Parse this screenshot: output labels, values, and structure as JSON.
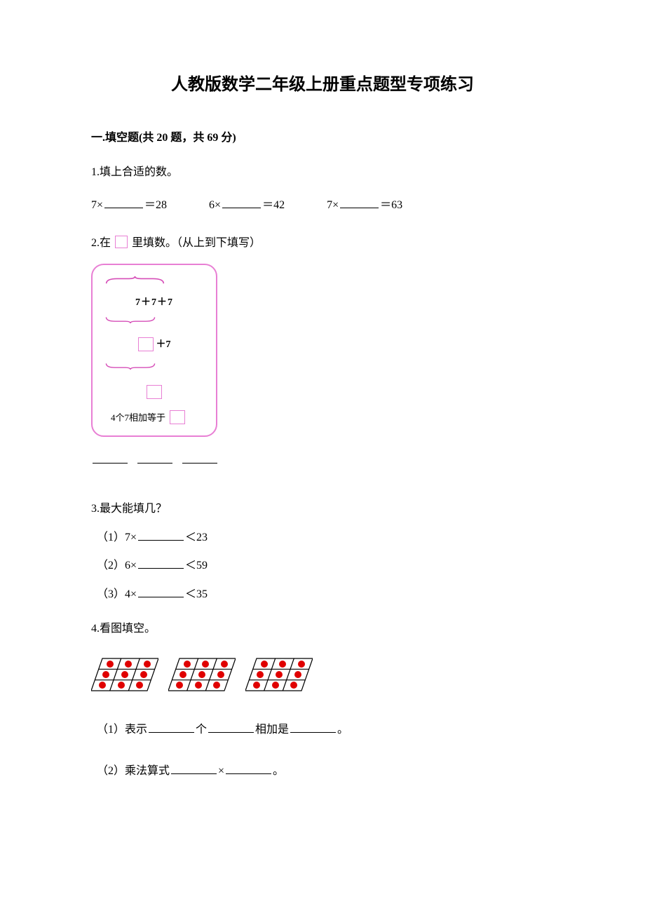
{
  "title": "人教版数学二年级上册重点题型专项练习",
  "section1": {
    "header": "一.填空题(共 20 题，共 69 分)",
    "q1": {
      "prompt": "1.填上合适的数。",
      "items": [
        {
          "left": "7×",
          "right": "＝28"
        },
        {
          "left": "6×",
          "right": "＝42"
        },
        {
          "left": "7×",
          "right": "＝63"
        }
      ]
    },
    "q2": {
      "prompt_prefix": "2.在",
      "prompt_suffix": "里填数。（从上到下填写）",
      "line1": "7＋7＋7",
      "line2_suffix": "＋7",
      "line4_prefix": "4个7相加等于"
    },
    "q3": {
      "prompt": "3.最大能填几？",
      "subs": [
        {
          "label": "（1）7×",
          "tail": "＜23"
        },
        {
          "label": "（2）6×",
          "tail": "＜59"
        },
        {
          "label": "（3）4×",
          "tail": "＜35"
        }
      ]
    },
    "q4": {
      "prompt": "4.看图填空。",
      "sub1_prefix": "（1）表示",
      "sub1_mid1": "个",
      "sub1_mid2": "相加是",
      "sub1_suffix": "。",
      "sub2_prefix": "（2）乘法算式",
      "sub2_mid": "×",
      "sub2_suffix": "。"
    }
  }
}
